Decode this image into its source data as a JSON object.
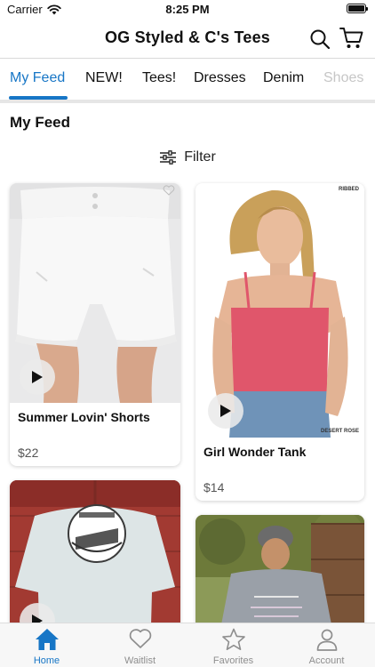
{
  "status_bar": {
    "carrier": "Carrier",
    "time": "8:25 PM"
  },
  "header": {
    "title": "OG Styled & C's Tees",
    "icons": [
      "search-icon",
      "cart-icon"
    ]
  },
  "tabs": [
    {
      "label": "My Feed",
      "active": true
    },
    {
      "label": "NEW!"
    },
    {
      "label": "Tees!"
    },
    {
      "label": "Dresses"
    },
    {
      "label": "Denim"
    },
    {
      "label": "Shoes"
    }
  ],
  "feed": {
    "title": "My Feed",
    "filter_label": "Filter"
  },
  "products": [
    {
      "name": "Summer Lovin' Shorts",
      "price": "$22"
    },
    {
      "name": "Girl Wonder Tank",
      "price": "$14",
      "image_tags": [
        "RIBBED",
        "DESERT ROSE"
      ]
    },
    {
      "name": "",
      "price": ""
    },
    {
      "name": "",
      "price": ""
    }
  ],
  "tab_bar": [
    {
      "label": "Home",
      "icon": "home-icon",
      "active": true
    },
    {
      "label": "Waitlist",
      "icon": "heart-icon"
    },
    {
      "label": "Favorites",
      "icon": "star-icon"
    },
    {
      "label": "Account",
      "icon": "person-icon"
    }
  ],
  "colors": {
    "accent": "#1776c6",
    "tab_inactive": "#8e8e8e",
    "tank_pink": "#e0566b"
  }
}
